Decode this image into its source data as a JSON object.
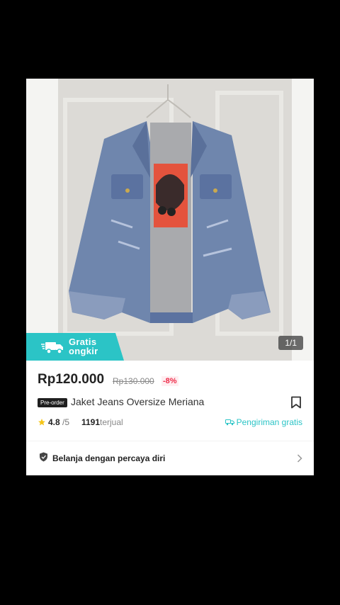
{
  "gallery": {
    "counter": "1/1"
  },
  "badge": {
    "line1": "Gratis",
    "line2": "ongkir"
  },
  "product": {
    "price": "Rp120.000",
    "original_price": "Rp130.000",
    "discount": "-8%",
    "preorder_tag": "Pre-order",
    "title": "Jaket Jeans Oversize Meriana",
    "rating": "4.8",
    "rating_max": "/5",
    "sold_count": "1191",
    "sold_label": "terjual",
    "shipping": "Pengiriman gratis"
  },
  "trust": {
    "label": "Belanja dengan percaya diri"
  },
  "colors": {
    "accent": "#2bc4c6",
    "discount": "#ee2d4a",
    "star": "#f5c518"
  },
  "icons": [
    "truck-icon",
    "bookmark-icon",
    "star-icon",
    "truck-small-icon",
    "shield-icon",
    "chevron-right-icon"
  ]
}
